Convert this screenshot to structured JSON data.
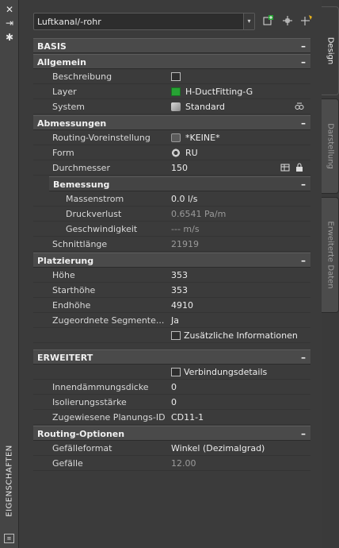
{
  "window": {
    "title": "EIGENSCHAFTEN",
    "controls": {
      "close": "✕",
      "pin": "⇥",
      "settings": "✱"
    },
    "foot_icon": "properties-icon"
  },
  "toolbar": {
    "selection": "Luftkanal/-rohr",
    "dropdown_arrow": "▾"
  },
  "tabs": [
    {
      "label": "Design"
    },
    {
      "label": "Darstellung"
    },
    {
      "label": "Erweiterte Daten"
    }
  ],
  "sections": {
    "basis": {
      "label": "BASIS"
    },
    "allgemein": {
      "label": "Allgemein"
    },
    "abmessungen": {
      "label": "Abmessungen"
    },
    "bemessung": {
      "label": "Bemessung"
    },
    "platzierung": {
      "label": "Platzierung"
    },
    "erweitert": {
      "label": "ERWEITERT"
    },
    "routing": {
      "label": "Routing-Optionen"
    },
    "collapse_glyph": "–"
  },
  "props": {
    "beschreibung": {
      "key": "Beschreibung"
    },
    "layer": {
      "key": "Layer",
      "value": "H-DuctFitting-G"
    },
    "system": {
      "key": "System",
      "value": "Standard"
    },
    "routing_preset": {
      "key": "Routing-Voreinstellung",
      "value": "*KEINE*"
    },
    "form": {
      "key": "Form",
      "value": "RU"
    },
    "durchmesser": {
      "key": "Durchmesser",
      "value": "150"
    },
    "massenstrom": {
      "key": "Massenstrom",
      "value": "0.0 l/s"
    },
    "druckverlust": {
      "key": "Druckverlust",
      "value": "0.6541 Pa/m"
    },
    "geschwindigkeit": {
      "key": "Geschwindigkeit",
      "value": "--- m/s"
    },
    "schnittlaenge": {
      "key": "Schnittlänge",
      "value": "21919"
    },
    "hoehe": {
      "key": "Höhe",
      "value": "353"
    },
    "starthoehe": {
      "key": "Starthöhe",
      "value": "353"
    },
    "endhoehe": {
      "key": "Endhöhe",
      "value": "4910"
    },
    "segmente": {
      "key": "Zugeordnete Segmente...",
      "value": "Ja"
    },
    "zusaetzlich": {
      "value": "Zusätzliche Informationen"
    },
    "verbindung": {
      "value": "Verbindungsdetails"
    },
    "innendaemmung": {
      "key": "Innendämmungsdicke",
      "value": "0"
    },
    "isolierung": {
      "key": "Isolierungsstärke",
      "value": "0"
    },
    "planungs_id": {
      "key": "Zugewiesene Planungs-ID",
      "value": "CD11-1"
    },
    "gefaelleformat": {
      "key": "Gefälleformat",
      "value": "Winkel (Dezimalgrad)"
    },
    "gefaelle": {
      "key": "Gefälle",
      "value": "12.00"
    }
  },
  "colors": {
    "layer_swatch": "#27a334",
    "panel_bg": "#3b3b3b",
    "section_bg": "#4a4a4a"
  }
}
